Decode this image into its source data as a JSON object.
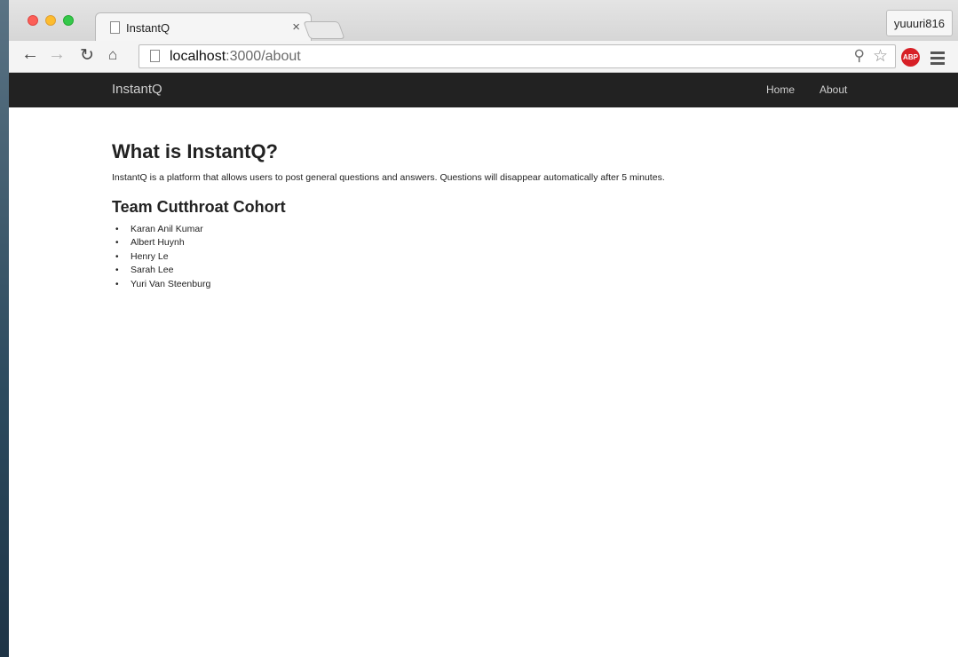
{
  "browser": {
    "tab_title": "InstantQ",
    "tab_close_glyph": "×",
    "profile_name": "yuuuri816",
    "url_host": "localhost",
    "url_path": ":3000/about",
    "extension_label": "ABP",
    "icons": [
      "back-arrow-icon",
      "forward-arrow-icon",
      "reload-icon",
      "home-icon",
      "page-icon",
      "zoom-icon",
      "star-icon",
      "adblock-icon",
      "menu-icon"
    ]
  },
  "navbar": {
    "brand": "InstantQ",
    "links": [
      {
        "label": "Home"
      },
      {
        "label": "About"
      }
    ],
    "background": "#222222"
  },
  "content": {
    "title": "What is InstantQ?",
    "intro": "InstantQ is a platform that allows users to post general questions and answers. Questions will disappear automatically after 5 minutes.",
    "team_title": "Team Cutthroat Cohort",
    "members": [
      "Karan Anil Kumar",
      "Albert Huynh",
      "Henry Le",
      "Sarah Lee",
      "Yuri Van Steenburg"
    ]
  }
}
